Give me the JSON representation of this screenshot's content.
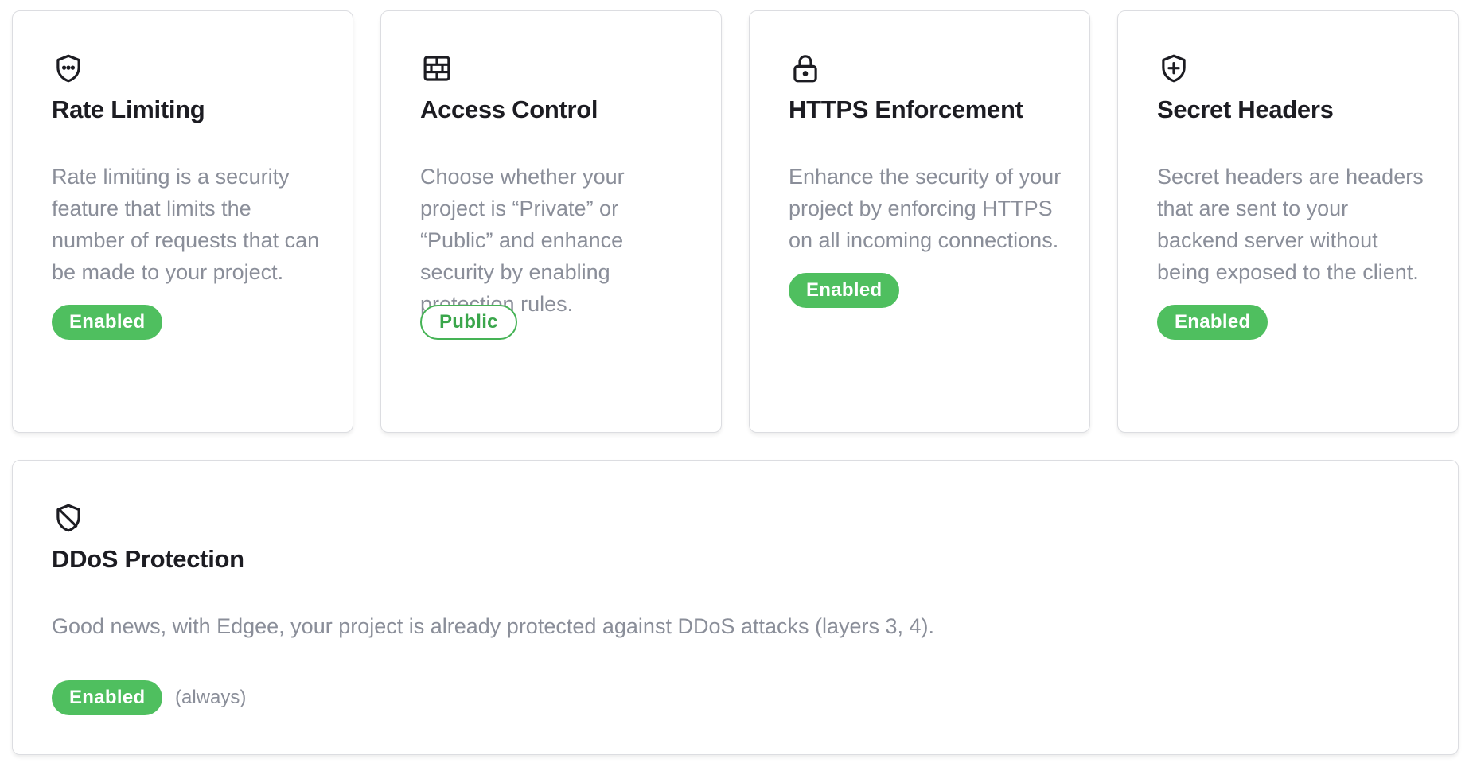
{
  "colors": {
    "badge_green": "#4fbf5f",
    "badge_outline_green": "#45b355",
    "text_title": "#1c1c22",
    "text_muted": "#8a8e99",
    "card_border": "#dcdde1"
  },
  "cards": [
    {
      "icon": "shield-dots-icon",
      "title": "Rate Limiting",
      "description": "Rate limiting is a security feature that limits the number of requests that can be made to your project.",
      "badge": "Enabled"
    },
    {
      "icon": "firewall-brick-icon",
      "title": "Access Control",
      "description": "Choose whether your project is “Private” or “Public” and enhance security by enabling protection rules.",
      "badge": "Public"
    },
    {
      "icon": "lock-icon",
      "title": "HTTPS Enforcement",
      "description": "Enhance the security of your project by enforcing HTTPS on all incoming connections.",
      "badge": "Enabled"
    },
    {
      "icon": "shield-plus-icon",
      "title": "Secret Headers",
      "description": "Secret headers are headers that are sent to your backend server without being exposed to the client.",
      "badge": "Enabled"
    }
  ],
  "ddos": {
    "icon": "shield-off-icon",
    "title": "DDoS Protection",
    "description": "Good news, with Edgee, your project is already protected against DDoS attacks (layers 3, 4).",
    "badge": "Enabled",
    "note": "(always)"
  }
}
